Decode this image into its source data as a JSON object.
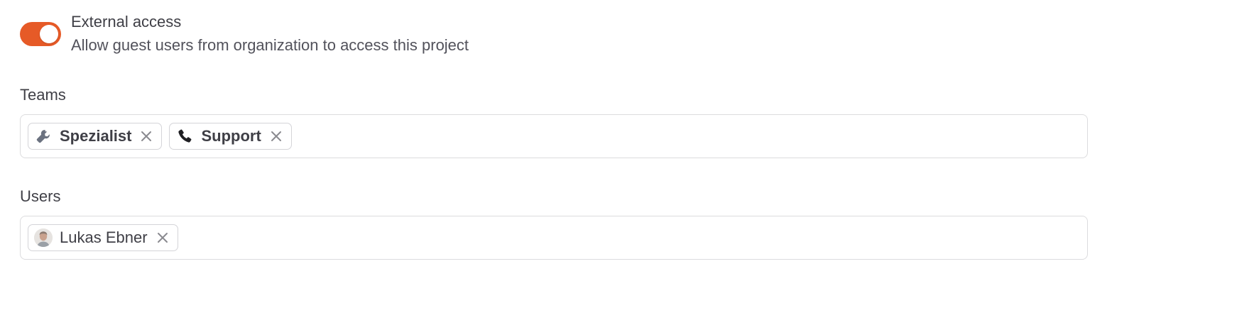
{
  "external_access": {
    "title": "External access",
    "description": "Allow guest users from organization to access this project",
    "enabled": true,
    "accent_color": "#e65a27"
  },
  "teams": {
    "label": "Teams",
    "chips": [
      {
        "label": "Spezialist",
        "icon": "wrench-icon"
      },
      {
        "label": "Support",
        "icon": "phone-icon"
      }
    ]
  },
  "users": {
    "label": "Users",
    "chips": [
      {
        "label": "Lukas Ebner",
        "icon": "avatar"
      }
    ]
  }
}
